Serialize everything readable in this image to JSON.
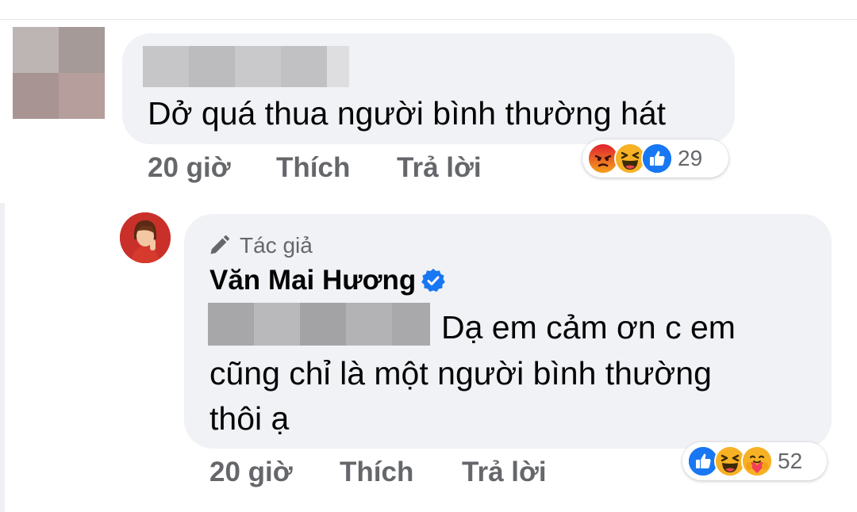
{
  "first_comment": {
    "text": "Dở quá thua người bình thường hát",
    "time": "20 giờ",
    "like_label": "Thích",
    "reply_label": "Trả lời",
    "reactions": {
      "icons": [
        "angry-icon",
        "haha-icon",
        "like-icon"
      ],
      "count": "29"
    }
  },
  "reply": {
    "author_badge": "Tác giả",
    "author_name": "Văn Mai Hương",
    "verified": true,
    "text_lines": [
      "Dạ em cảm ơn c em",
      "cũng chỉ là một người bình thường",
      "thôi ạ"
    ],
    "time": "20 giờ",
    "like_label": "Thích",
    "reply_label": "Trả lời",
    "reactions": {
      "icons": [
        "like-icon",
        "haha-icon",
        "care-icon"
      ],
      "count": "52"
    }
  },
  "colors": {
    "bubble": "#f0f2f5",
    "meta_text": "#65676b",
    "like_blue": "#1877f2",
    "angry": "#e9710f",
    "haha": "#f7b125"
  }
}
